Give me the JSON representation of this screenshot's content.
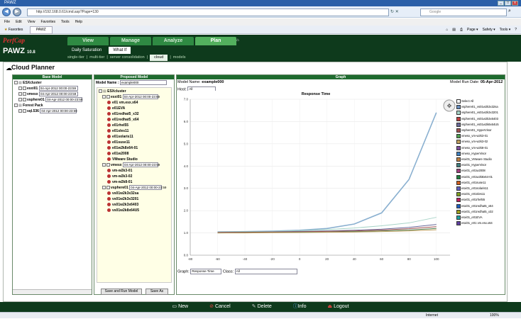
{
  "browser": {
    "title": "PAWZ",
    "url": "http://192.168.0.61/cmd.asp?Page=130",
    "search_placeholder": "Google",
    "menu": [
      "File",
      "Edit",
      "View",
      "Favorites",
      "Tools",
      "Help"
    ],
    "favorites_label": "Favorites",
    "tab_label": "PAWZ",
    "toolbar_items": [
      "Page ▾",
      "Safety ▾",
      "Tools ▾"
    ],
    "status_zone": "Internet",
    "zoom": "100%"
  },
  "app": {
    "logo_text": "PerfCap",
    "product": "PAWZ",
    "version": "10.8",
    "nav": [
      "View",
      "Manage",
      "Analyze",
      "Plan"
    ],
    "subnav": [
      "Daily Saturation",
      "What If"
    ],
    "subnav2": [
      "single-tier",
      "multi-tier",
      "server consolidation",
      "cloud",
      "models"
    ],
    "page_title": "Cloud Planner"
  },
  "base_model": {
    "header": "Base Model",
    "nodes": [
      {
        "label": "ESXcluster",
        "date": ""
      },
      {
        "label": "esxi01",
        "date": "04-Apr-2012 00:00-23:59"
      },
      {
        "label": "vmesx",
        "date": "04-Apr-2012 00:00-23:59"
      },
      {
        "label": "vsphere01",
        "date": "04-Apr-2012 00:00-23:59"
      },
      {
        "label": "Forest Pack",
        "date": ""
      },
      {
        "label": "sql.536",
        "date": "04-Apr-2012 00:00-23:59"
      }
    ]
  },
  "proposed_model": {
    "header": "Proposed Model",
    "model_name_label": "Model Name :",
    "model_name_value": "example000",
    "cluster_label": "ESXcluster",
    "groups": [
      {
        "label": "esxi01",
        "date": "04-Apr-2012 00:00-23:59",
        "vms": [
          "e01 vm.esx.x64",
          "e01EVA",
          "e01redhat5_x32",
          "e01redhat5_x64",
          "e01rhel55",
          "e01sles11",
          "e01solaris11",
          "e01suse11",
          "e01w2k8x64-01",
          "e01w2008",
          "VMware Studio"
        ]
      },
      {
        "label": "vmesx",
        "date": "04-Apr-2012 00:00-23:59",
        "vms": [
          "vm-w2k3-01",
          "vm-w2k3-02",
          "vm-w2k8-01"
        ]
      },
      {
        "label": "vsphere01",
        "date": "04-Apr-2012 00:00-23:59",
        "vms": [
          "vs01w2k3x32sa",
          "vs01w2k3x3201",
          "vs01w2k3x6403",
          "vs01w2k8x64U5"
        ]
      }
    ],
    "save_run_button": "Save and Run Model",
    "save_as_button": "Save As"
  },
  "graph": {
    "header": "Graph",
    "model_name_label": "Model Name:",
    "model_name_value": "example000",
    "run_date_label": "Model Run Date:",
    "run_date_value": "05-Apr-2012",
    "host_label": "Host:",
    "host_value": "All",
    "plot_title": "Response Time",
    "graph_label": "Graph:",
    "graph_value": "Response Time",
    "class_label": "Class:",
    "class_value": "All"
  },
  "chart_data": {
    "type": "line",
    "title": "Response Time",
    "xlabel": "",
    "ylabel": "",
    "x": [
      -60,
      -40,
      -20,
      0,
      20,
      40,
      60,
      80,
      100
    ],
    "xlim": [
      -80,
      110
    ],
    "ylim": [
      0,
      7
    ],
    "x_ticks": [
      "-80",
      "-60",
      "-40",
      "-20",
      "0",
      "20",
      "40",
      "60",
      "80",
      "100"
    ],
    "y_ticks": [
      "0.0",
      "1.0",
      "2.0",
      "3.0",
      "4.0",
      "5.0",
      "6.0",
      "7.0"
    ],
    "series": [
      {
        "values": [
          1.05,
          1.06,
          1.08,
          1.12,
          1.2,
          1.4,
          1.9,
          3.4,
          6.4
        ],
        "color": "#8ab0d0"
      },
      {
        "values": [
          1.05,
          1.06,
          1.07,
          1.1,
          1.15,
          1.22,
          1.32,
          1.45,
          1.7
        ],
        "color": "#a8d4c8"
      },
      {
        "values": [
          1.03,
          1.04,
          1.05,
          1.07,
          1.09,
          1.12,
          1.17,
          1.25,
          1.38
        ],
        "color": "#6a6a9a"
      },
      {
        "values": [
          1.02,
          1.03,
          1.04,
          1.05,
          1.07,
          1.09,
          1.13,
          1.19,
          1.28
        ],
        "color": "#a05050"
      },
      {
        "values": [
          1.0,
          1.01,
          1.02,
          1.03,
          1.04,
          1.06,
          1.09,
          1.13,
          1.2
        ],
        "color": "#508050"
      },
      {
        "values": [
          1.0,
          1.0,
          1.01,
          1.02,
          1.03,
          1.04,
          1.06,
          1.09,
          1.14
        ],
        "color": "#c0a060"
      }
    ],
    "legend": [
      {
        "name": "Select All",
        "color": "#ffffff"
      },
      {
        "name": "vsphere01_vs01w2k3x32sa",
        "color": "#6a8fc0"
      },
      {
        "name": "vsphere01_vs01w2k3x3201",
        "color": "#a8d4c8"
      },
      {
        "name": "vsphere01_vs01w2k3x6403",
        "color": "#c04040"
      },
      {
        "name": "vsphere01_vs01w2k8x64U5",
        "color": "#6a6a9a"
      },
      {
        "name": "vsphere01_HyperVisor",
        "color": "#a05050"
      },
      {
        "name": "vmesx_vm-w2k3-01",
        "color": "#50a050"
      },
      {
        "name": "vmesx_vm-w2k3-02",
        "color": "#c0a060"
      },
      {
        "name": "vmesx_vm-w2k8-01",
        "color": "#8050a0"
      },
      {
        "name": "vmesx_HyperVisor",
        "color": "#4080c0"
      },
      {
        "name": "esxi01_VMware Studio",
        "color": "#c08040"
      },
      {
        "name": "esxi01_HyperVisor",
        "color": "#408080"
      },
      {
        "name": "esxi01_e01w2008",
        "color": "#a04080"
      },
      {
        "name": "esxi01_e01w2k8x64-01",
        "color": "#208040"
      },
      {
        "name": "esxi01_e01suse11",
        "color": "#d06020"
      },
      {
        "name": "esxi01_e01solaris11",
        "color": "#6060c0"
      },
      {
        "name": "esxi01_e01sles11",
        "color": "#80a020"
      },
      {
        "name": "esxi01_e01rhel55",
        "color": "#c02060"
      },
      {
        "name": "esxi01_e01redhat5_x64",
        "color": "#2060c0"
      },
      {
        "name": "esxi01_e01redhat5_x32",
        "color": "#a0a020"
      },
      {
        "name": "esxi01_e01EVA",
        "color": "#20a0a0"
      },
      {
        "name": "esxi01_e01 vm.esx.x64",
        "color": "#6040a0"
      }
    ]
  },
  "footer": {
    "new": "New",
    "cancel": "Cancel",
    "delete": "Delete",
    "info": "Info",
    "logout": "Logout"
  }
}
